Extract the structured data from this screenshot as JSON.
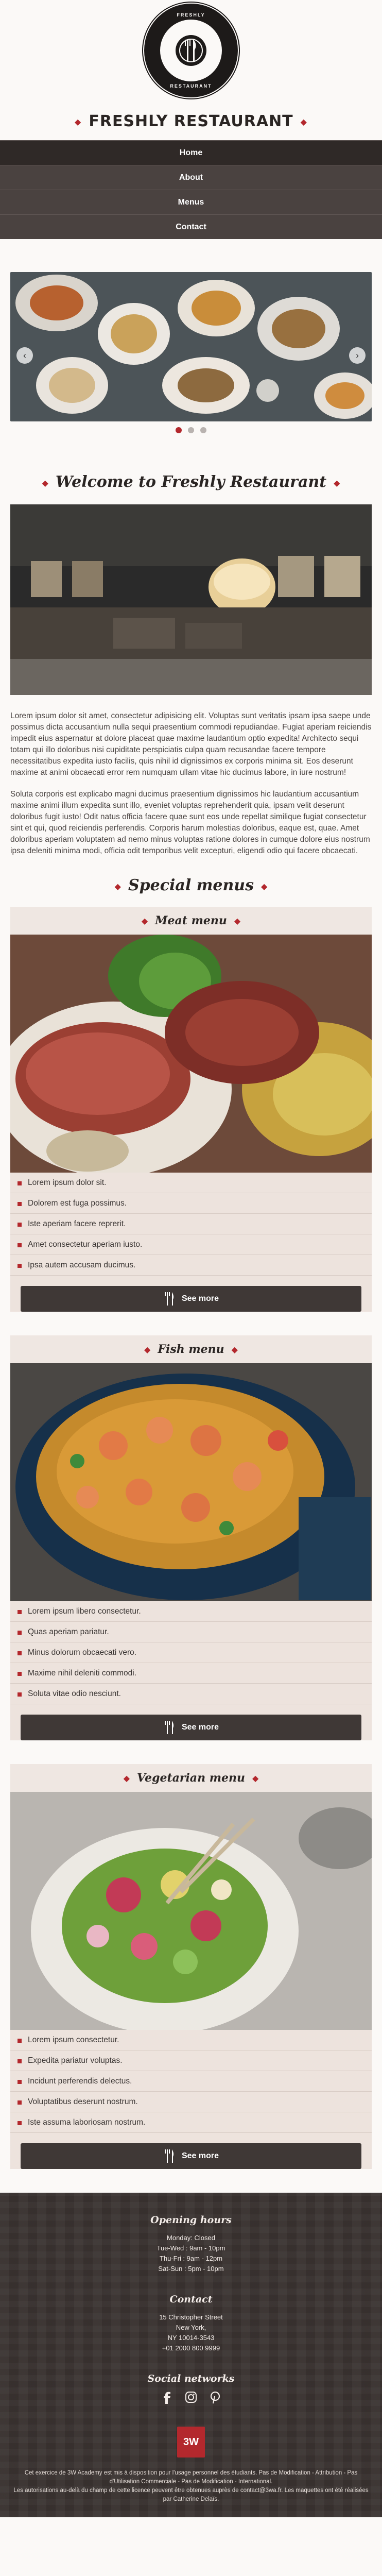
{
  "header": {
    "logo_ring_top": "FRESHLY",
    "logo_ring_bottom": "RESTAURANT",
    "site_title": "FRESHLY RESTAURANT"
  },
  "nav": {
    "items": [
      {
        "label": "Home",
        "active": true
      },
      {
        "label": "About"
      },
      {
        "label": "Menus"
      },
      {
        "label": "Contact"
      }
    ]
  },
  "slider": {
    "dots": 3,
    "active_dot": 0
  },
  "welcome": {
    "title": "Welcome to Freshly Restaurant",
    "paragraphs": [
      "Lorem ipsum dolor sit amet, consectetur adipisicing elit. Voluptas sunt veritatis ipsam ipsa saepe unde possimus dicta accusantium nulla sequi praesentium commodi repudiandae. Fugiat aperiam reiciendis impedit eius aspernatur at dolore placeat quae maxime laudantium optio expedita! Architecto sequi totam qui illo doloribus nisi cupiditate perspiciatis culpa quam recusandae facere tempore necessitatibus expedita iusto facilis, quis nihil id dignissimos ex corporis minima sit. Eos deserunt maxime at animi obcaecati error rem numquam ullam vitae hic ducimus labore, in iure nostrum!",
      "Soluta corporis est explicabo magni ducimus praesentium dignissimos hic laudantium accusantium maxime animi illum expedita sunt illo, eveniet voluptas reprehenderit quia, ipsam velit deserunt doloribus fugit iusto! Odit natus officia facere quae sunt eos unde repellat similique fugiat consectetur sint et qui, quod reiciendis perferendis. Corporis harum molestias doloribus, eaque est, quae. Amet doloribus aperiam voluptatem ad nemo minus voluptas ratione dolores in cumque dolore eius nostrum ipsa deleniti minima modi, officia odit temporibus velit excepturi, eligendi odio qui facere obcaecati."
    ]
  },
  "special_menus_title": "Special menus",
  "menus": [
    {
      "title": "Meat menu",
      "items": [
        "Lorem ipsum dolor sit.",
        "Dolorem est fuga possimus.",
        "Iste aperiam facere reprerit.",
        "Amet consectetur aperiam iusto.",
        "Ipsa autem accusam ducimus."
      ],
      "button": "See more"
    },
    {
      "title": "Fish menu",
      "items": [
        "Lorem ipsum libero consectetur.",
        "Quas aperiam pariatur.",
        "Minus dolorum obcaecati vero.",
        "Maxime nihil deleniti commodi.",
        "Soluta vitae odio nesciunt."
      ],
      "button": "See more"
    },
    {
      "title": "Vegetarian menu",
      "items": [
        "Lorem ipsum consectetur.",
        "Expedita pariatur voluptas.",
        "Incidunt perferendis delectus.",
        "Voluptatibus deserunt nostrum.",
        "Iste assuma laboriosam nostrum."
      ],
      "button": "See more"
    }
  ],
  "footer": {
    "hours_heading": "Opening hours",
    "hours": [
      "Monday: Closed",
      "Tue-Wed : 9am - 10pm",
      "Thu-Fri : 9am - 12pm",
      "Sat-Sun : 5pm - 10pm"
    ],
    "contact_heading": "Contact",
    "contact": [
      "15 Christopher Street",
      "New York,",
      "NY 10014-3543",
      "+01 2000 800 9999"
    ],
    "social_heading": "Social networks",
    "social_icons": [
      "facebook-icon",
      "instagram-icon",
      "pinterest-icon"
    ],
    "badge_text": "3W",
    "credits_1": "Cet exercice de 3W Academy est mis à disposition pour l'usage personnel des étudiants. Pas de Modification - Attribution - Pas d'Utilisation Commerciale - Pas de Modification - International.",
    "credits_2": "Les autorisations au-delà du champ de cette licence peuvent être obtenues auprès de contact@3wa.fr. Les maquettes ont été réalisées par Catherine Delaïs."
  },
  "colors": {
    "accent": "#b3282d",
    "nav_bg": "#4a4240",
    "card_bg": "#ede3dd",
    "footer_bg": "#3a3331"
  }
}
